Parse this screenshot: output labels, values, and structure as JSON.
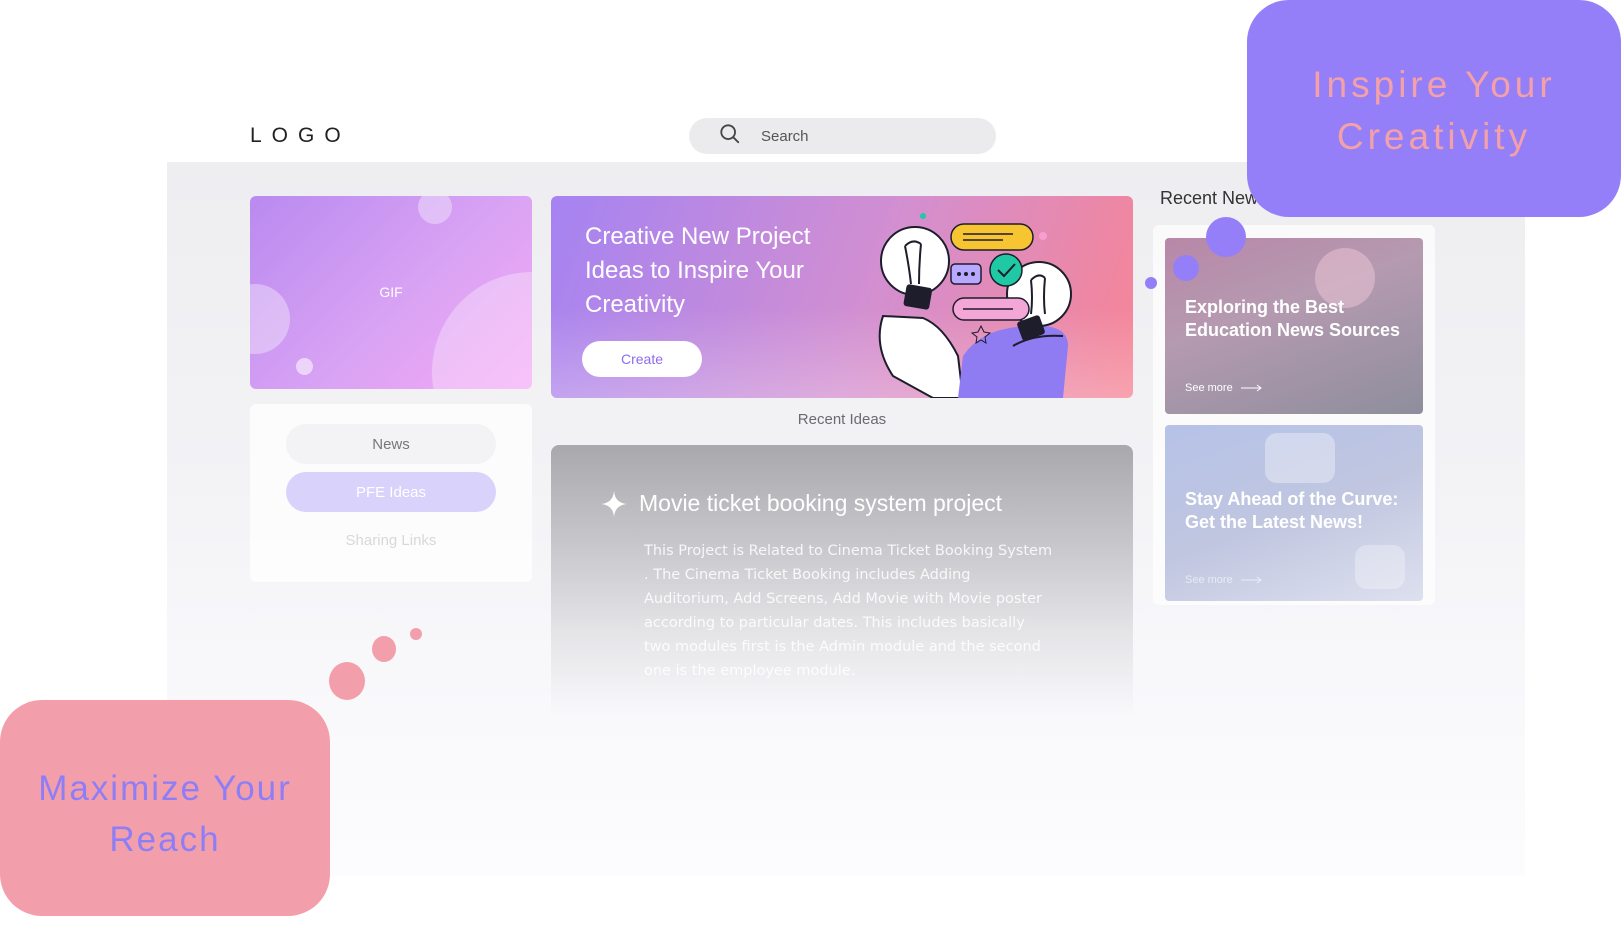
{
  "header": {
    "logo": "LOGO",
    "search_placeholder": "Search"
  },
  "gif_card": {
    "label": "GIF"
  },
  "side_nav": {
    "items": [
      {
        "label": "News"
      },
      {
        "label": "PFE Ideas"
      },
      {
        "label": "Sharing Links"
      }
    ]
  },
  "hero": {
    "title": "Creative New Project Ideas to Inspire Your Creativity",
    "button_label": "Create"
  },
  "recent_ideas": {
    "label": "Recent Ideas",
    "card": {
      "title": "Movie ticket booking system project",
      "description": "This Project is Related to Cinema Ticket Booking System . The Cinema Ticket Booking includes Adding Auditorium, Add Screens, Add Movie with Movie poster according to particular dates. This includes basically two modules first is the Admin module and the second one is the employee module."
    }
  },
  "recent_news": {
    "title": "Recent News",
    "items": [
      {
        "title": "Exploring the Best Education News Sources",
        "see_more": "See more"
      },
      {
        "title": "Stay Ahead of the Curve: Get the Latest News!",
        "see_more": "See more"
      }
    ]
  },
  "promos": {
    "top": "Inspire Your Creativity",
    "bottom": "Maximize Your Reach"
  },
  "colors": {
    "accent_purple": "#957ff8",
    "accent_pink": "#f39fab",
    "hero_gradient_start": "#a583f2",
    "hero_gradient_end": "#f78494"
  },
  "icons": [
    "search-icon",
    "sparkle-icon",
    "arrow-right-icon",
    "lightbulb-illustration"
  ]
}
